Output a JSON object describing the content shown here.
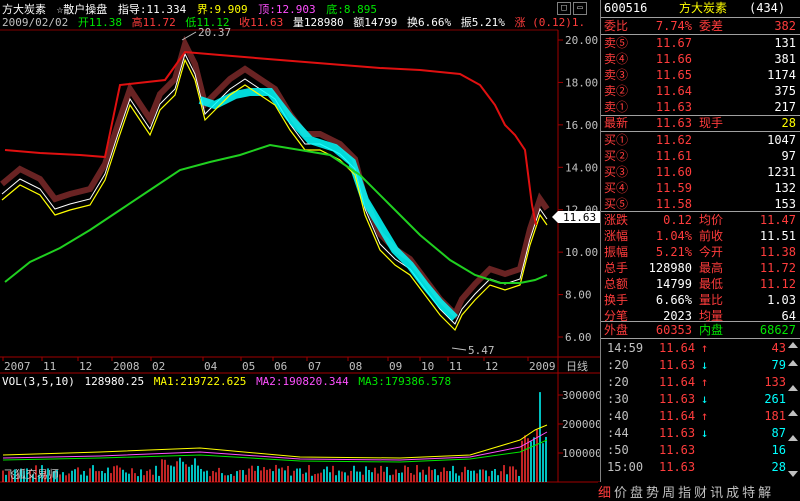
{
  "title": {
    "name": "方大炭素",
    "indicator": "☆散户操盘",
    "zhidao": "指导:11.334",
    "jie": "界:9.909",
    "ding": "顶:12.903",
    "di": "底:8.895"
  },
  "info": {
    "date": "2009/02/02",
    "open": "开11.38",
    "high": "高11.72",
    "low": "低11.12",
    "close": "收11.63",
    "volume": "量128980",
    "amount": "额14799",
    "turnover": "换6.66%",
    "amplitude": "振5.21%",
    "change": "涨 (0.12)1."
  },
  "annotations": {
    "peak": "20.37",
    "trough": "5.47",
    "current_price": "11.63"
  },
  "y_axis": [
    "20.00",
    "18.00",
    "16.00",
    "14.00",
    "12.00",
    "10.00",
    "8.00",
    "6.00"
  ],
  "x_axis": [
    "2007",
    "11",
    "12",
    "2008",
    "02",
    "04",
    "05",
    "06",
    "07",
    "08",
    "09",
    "10",
    "11",
    "12",
    "2009"
  ],
  "period_label": "日线",
  "vol_legend": {
    "vol": "VOL(3,5,10)",
    "vol_value": "128980.25",
    "ma1": "MA1:219722.625",
    "ma2": "MA2:190820.344",
    "ma3": "MA3:179386.578"
  },
  "vol_axis": [
    "300000",
    "200000",
    "100000"
  ],
  "watermark": "飞狐交易师",
  "panel": {
    "code": "600516",
    "name": "方大炭素",
    "count": "(434)",
    "weibi": {
      "label": "委比",
      "value": "7.74%",
      "label2": "委差",
      "value2": "382"
    },
    "sells": [
      {
        "label": "卖⑤",
        "price": "11.67",
        "vol": "131"
      },
      {
        "label": "卖④",
        "price": "11.66",
        "vol": "381"
      },
      {
        "label": "卖③",
        "price": "11.65",
        "vol": "1174"
      },
      {
        "label": "卖②",
        "price": "11.64",
        "vol": "375"
      },
      {
        "label": "卖①",
        "price": "11.63",
        "vol": "217"
      }
    ],
    "latest": {
      "label": "最新",
      "value": "11.63",
      "label2": "现手",
      "value2": "28"
    },
    "buys": [
      {
        "label": "买①",
        "price": "11.62",
        "vol": "1047"
      },
      {
        "label": "买②",
        "price": "11.61",
        "vol": "97"
      },
      {
        "label": "买③",
        "price": "11.60",
        "vol": "1231"
      },
      {
        "label": "买④",
        "price": "11.59",
        "vol": "132"
      },
      {
        "label": "买⑤",
        "price": "11.58",
        "vol": "153"
      }
    ],
    "stats": [
      {
        "l1": "涨跌",
        "v1": "0.12",
        "l2": "均价",
        "v2": "11.47"
      },
      {
        "l1": "涨幅",
        "v1": "1.04%",
        "l2": "前收",
        "v2": "11.51"
      },
      {
        "l1": "振幅",
        "v1": "5.21%",
        "l2": "今开",
        "v2": "11.38"
      },
      {
        "l1": "总手",
        "v1": "128980",
        "l2": "最高",
        "v2": "11.72"
      },
      {
        "l1": "总额",
        "v1": "14799",
        "l2": "最低",
        "v2": "11.12"
      },
      {
        "l1": "换手",
        "v1": "6.66%",
        "l2": "量比",
        "v2": "1.03"
      },
      {
        "l1": "分笔",
        "v1": "2023",
        "l2": "均量",
        "v2": "64"
      }
    ],
    "outer": {
      "label": "外盘",
      "value": "60353",
      "label2": "内盘",
      "value2": "68627"
    },
    "ticks": [
      {
        "time": "14:59",
        "price": "11.64",
        "dir": "↑",
        "vol": "43"
      },
      {
        "time": ":20",
        "price": "11.63",
        "dir": "↓",
        "vol": "79"
      },
      {
        "time": ":20",
        "price": "11.64",
        "dir": "↑",
        "vol": "133"
      },
      {
        "time": ":30",
        "price": "11.63",
        "dir": "↓",
        "vol": "261"
      },
      {
        "time": ":40",
        "price": "11.64",
        "dir": "↑",
        "vol": "181"
      },
      {
        "time": ":44",
        "price": "11.63",
        "dir": "↓",
        "vol": "87"
      },
      {
        "time": ":50",
        "price": "11.63",
        "dir": "",
        "vol": "16"
      },
      {
        "time": "15:00",
        "price": "11.63",
        "dir": "",
        "vol": "28"
      }
    ]
  },
  "bottom_nav": [
    "细",
    "价",
    "盘",
    "势",
    "周",
    "指",
    "财",
    "讯",
    "成",
    "特",
    "解"
  ]
}
